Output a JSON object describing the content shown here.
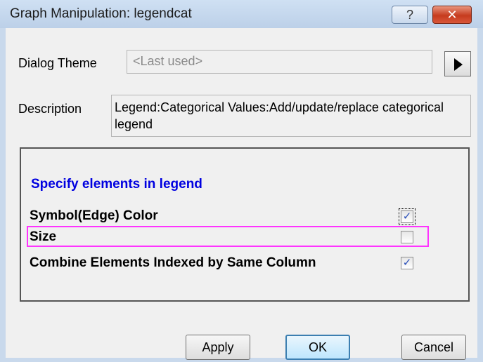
{
  "window": {
    "title": "Graph Manipulation: legendcat",
    "help_glyph": "?",
    "close_glyph": "✕"
  },
  "dialog_theme": {
    "label": "Dialog Theme",
    "value": "<Last used>"
  },
  "description": {
    "label": "Description",
    "text": "Legend:Categorical Values:Add/update/replace categorical legend"
  },
  "legend_elements": {
    "heading": "Specify elements in legend",
    "options": [
      {
        "label": "Symbol(Edge) Color",
        "checked": true
      },
      {
        "label": "Size",
        "checked": false
      },
      {
        "label": "Combine Elements Indexed by Same Column",
        "checked": true
      }
    ]
  },
  "buttons": {
    "apply": "Apply",
    "ok": "OK",
    "cancel": "Cancel"
  },
  "colors": {
    "heading": "#0000e0",
    "highlight": "#ff33ff",
    "close_button": "#c63b1e"
  }
}
